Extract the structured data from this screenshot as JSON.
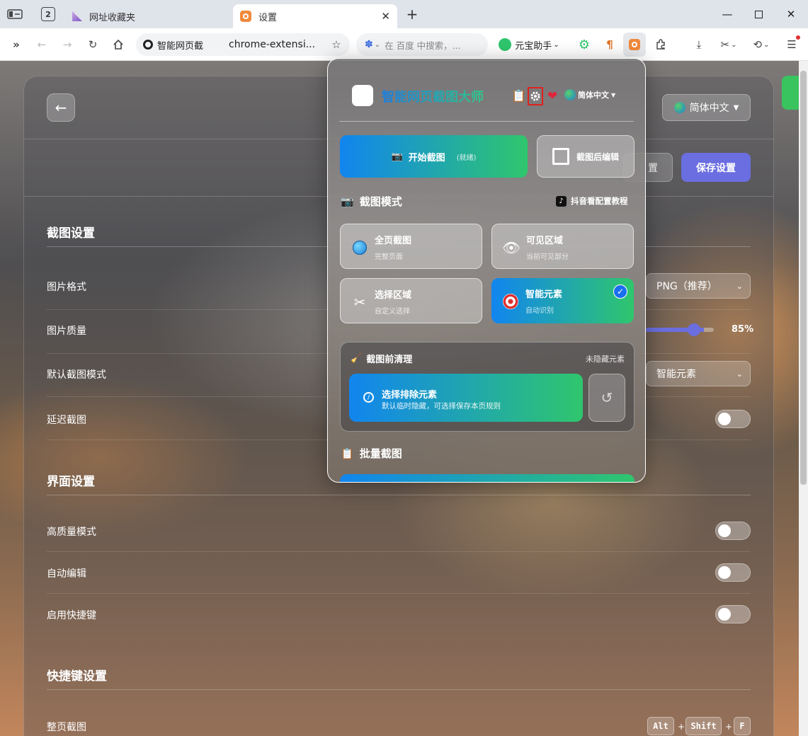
{
  "browser": {
    "tabs": [
      {
        "label": "网址收藏夹"
      },
      {
        "label": "设置"
      }
    ],
    "tab_count": "2",
    "new_tab": "+",
    "address": {
      "site_label": "智能网页截",
      "url": "chrome-extensi..."
    },
    "search": {
      "placeholder": "在 百度 中搜索，..."
    },
    "yuanbao": {
      "label": "元宝助手"
    }
  },
  "settings_page": {
    "back_label": "←",
    "language_label": "简体中文",
    "reset_label": "置",
    "save_label": "保存设置",
    "sections": {
      "capture": "截图设置",
      "interface": "界面设置",
      "shortcuts": "快捷键设置"
    },
    "rows": {
      "format": {
        "label": "图片格式",
        "value": "PNG（推荐）"
      },
      "quality": {
        "label": "图片质量",
        "value": "85%",
        "fraction": 0.85
      },
      "default_mode": {
        "label": "默认截图模式",
        "value": "智能元素"
      },
      "delay": {
        "label": "延迟截图",
        "on": false
      },
      "hq_mode": {
        "label": "高质量模式",
        "on": false
      },
      "auto_edit": {
        "label": "自动编辑",
        "on": false
      },
      "hotkeys": {
        "label": "启用快捷键",
        "on": false
      },
      "full_page": {
        "label": "整页截图",
        "keys": [
          "Alt",
          "Shift",
          "F"
        ]
      }
    }
  },
  "popup": {
    "title": "智能网页截图大师",
    "lang": "简体中文",
    "start": {
      "label": "开始截图",
      "status": "(就绪)"
    },
    "edit_after": "截图后编辑",
    "mode_section": "截图模式",
    "tutorial_link": "抖音看配置教程",
    "modes": [
      {
        "name": "全页截图",
        "desc": "完整页面",
        "selected": false
      },
      {
        "name": "可见区域",
        "desc": "当前可见部分",
        "selected": false
      },
      {
        "name": "选择区域",
        "desc": "自定义选择",
        "selected": false
      },
      {
        "name": "智能元素",
        "desc": "自动识别",
        "selected": true
      }
    ],
    "clean": {
      "title": "截图前清理",
      "status": "未隐藏元素",
      "exclude_label": "选择排除元素",
      "exclude_desc": "默认临时隐藏，可选择保存本页规则"
    },
    "batch_section": "批量截图"
  },
  "colors": {
    "accent": "#6a6ee0",
    "gradient_start": "#1185ef",
    "gradient_end": "#2fc66d",
    "check": "#1a6ef0"
  }
}
